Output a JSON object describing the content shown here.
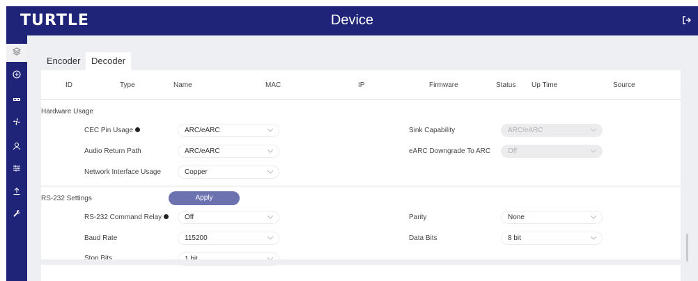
{
  "header": {
    "logo": "TURTLE",
    "title": "Device"
  },
  "tabs": [
    {
      "label": "Encoder",
      "active": false
    },
    {
      "label": "Decoder",
      "active": true
    }
  ],
  "table": {
    "columns": [
      "ID",
      "Type",
      "Name",
      "MAC",
      "IP",
      "Firmware",
      "Status",
      "Up Time",
      "Source"
    ]
  },
  "hardware_usage": {
    "title": "Hardware Usage",
    "rows_left": [
      {
        "label": "CEC Pin Usage",
        "info": true,
        "value": "ARC/eARC"
      },
      {
        "label": "Audio Return Path",
        "info": false,
        "value": "ARC/eARC"
      },
      {
        "label": "Network Interface Usage",
        "info": false,
        "value": "Copper"
      }
    ],
    "rows_right": [
      {
        "label": "Sink Capability",
        "value": "ARC/eARC",
        "disabled": true
      },
      {
        "label": "eARC Downgrade To ARC",
        "value": "Off",
        "disabled": true
      }
    ]
  },
  "rs232": {
    "title": "RS-232 Settings",
    "apply_label": "Apply",
    "rows_left": [
      {
        "label": "RS-232 Command Relay",
        "info": true,
        "value": "Off"
      },
      {
        "label": "Baud Rate",
        "info": false,
        "value": "115200"
      },
      {
        "label": "Stop Bits",
        "info": false,
        "value": "1 bit"
      }
    ],
    "rows_right": [
      {
        "label": "Parity",
        "value": "None"
      },
      {
        "label": "Data Bits",
        "value": "8 bit"
      }
    ]
  },
  "sidebar": {
    "items": [
      {
        "icon": "layers-icon",
        "active": true
      },
      {
        "icon": "add-circle-icon",
        "active": false
      },
      {
        "icon": "device-list-icon",
        "active": false
      },
      {
        "icon": "fan-icon",
        "active": false
      },
      {
        "icon": "user-icon",
        "active": false
      },
      {
        "icon": "sliders-icon",
        "active": false
      },
      {
        "icon": "upload-icon",
        "active": false
      },
      {
        "icon": "wrench-icon",
        "active": false
      }
    ]
  },
  "colors": {
    "brand": "#1f2478",
    "button": "#6c72b0",
    "background": "#eeeff2"
  }
}
